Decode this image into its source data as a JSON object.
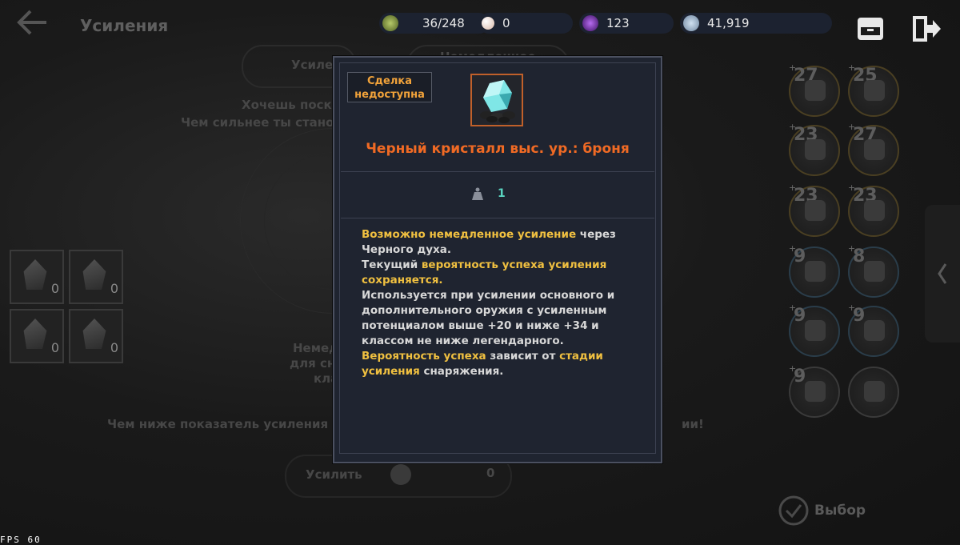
{
  "header": {
    "title": "Усиления"
  },
  "resources": {
    "bag": "36/248",
    "pearls": "0",
    "energy": "123",
    "silver": "41,919"
  },
  "background": {
    "tab_left": "Усиле",
    "tab_right": "Немедленное",
    "hint_line1": "Хочешь поск",
    "hint_line2": "Чем сильнее ты стано",
    "slot_qty": [
      "0",
      "0",
      "0",
      "0"
    ],
    "mid_line1": "Немед",
    "mid_line2": "для сн",
    "mid_line3": "кла",
    "bottom_hint": "Чем ниже показатель усиления сн",
    "bottom_hint_tail": "ии!",
    "enhance_label": "Усилить",
    "cost": "0",
    "confirm": "Выбор",
    "equipment_levels": [
      "27",
      "25",
      "23",
      "27",
      "23",
      "23",
      "9",
      "8",
      "9",
      "9",
      "9",
      ""
    ]
  },
  "modal": {
    "deal_status": "Сделка недоступна",
    "item_name": "Черный кристалл выс. ур.: броня",
    "weight": "1",
    "desc": {
      "p1_hl": "Возможно немедленное усиление",
      "p1_rest": " через Черного духа.",
      "p2_pre": "Текущий ",
      "p2_hl": "вероятность успеха усиления сохраняется.",
      "p3": "Используется при усилении основного и дополнительного оружия с усиленным потенциалом выше +20 и ниже +34 и классом не ниже легендарного.",
      "p4_hl1": "Вероятность успеха",
      "p4_mid": " зависит от ",
      "p4_hl2": "стадии усиления",
      "p4_rest": " снаряжения."
    }
  },
  "fps": "FPS  60",
  "colors": {
    "accent_orange": "#f06a24",
    "highlight_yellow": "#f0c040",
    "deal_orange": "#f2a33a"
  }
}
